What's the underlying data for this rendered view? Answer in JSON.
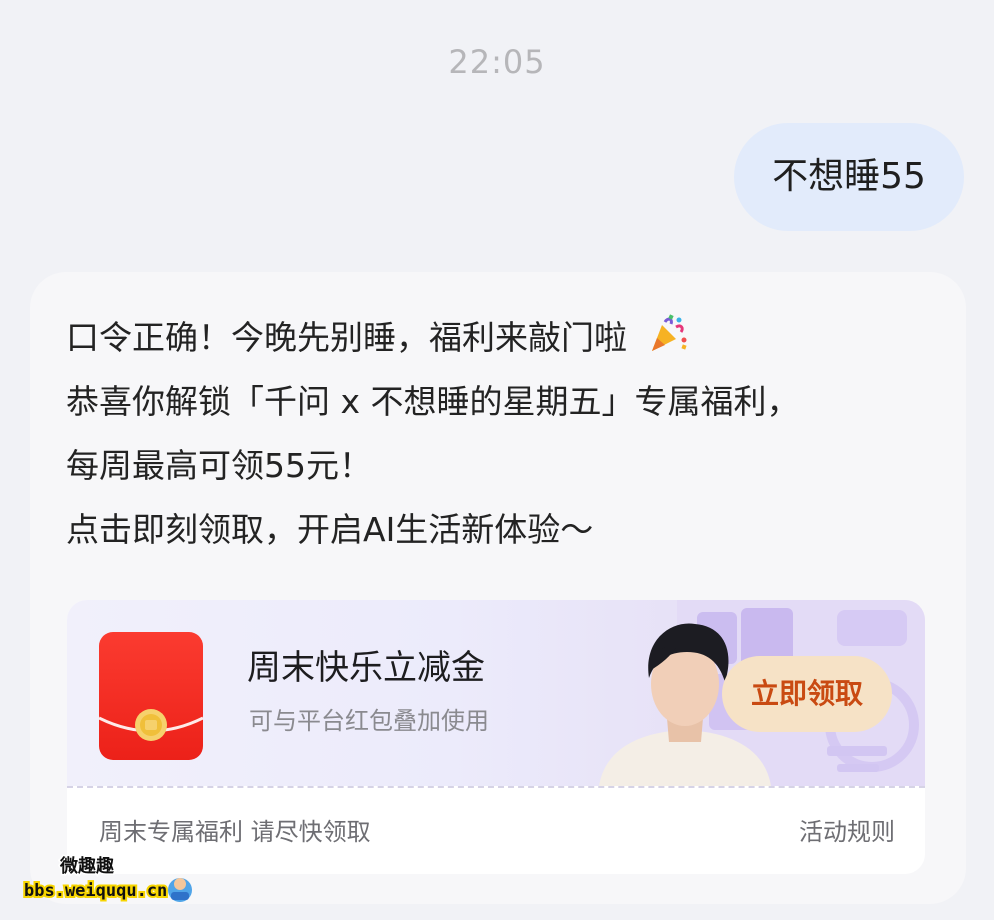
{
  "status": {
    "time": "22:05"
  },
  "user_message": {
    "text": "不想睡55"
  },
  "bot_message": {
    "lines": [
      "口令正确！今晚先别睡，福利来敲门啦",
      "恭喜你解锁「千问 x 不想睡的星期五」专属福利，",
      "每周最高可领55元！",
      "点击即刻领取，开启AI生活新体验～"
    ],
    "line1_icon": "party-popper-icon"
  },
  "coupon": {
    "title": "周末快乐立减金",
    "subtitle": "可与平台红包叠加使用",
    "claim_label": "立即领取",
    "footer_left": "周末专属福利 请尽快领取",
    "footer_right": "活动规则",
    "icon": "red-packet-icon",
    "colors": {
      "red": "#ef2a22",
      "button_bg": "#f6e2c6",
      "button_text": "#c94a12"
    }
  },
  "watermark": {
    "site": "bbs.weiququ.cn",
    "name": "微趣趣"
  }
}
